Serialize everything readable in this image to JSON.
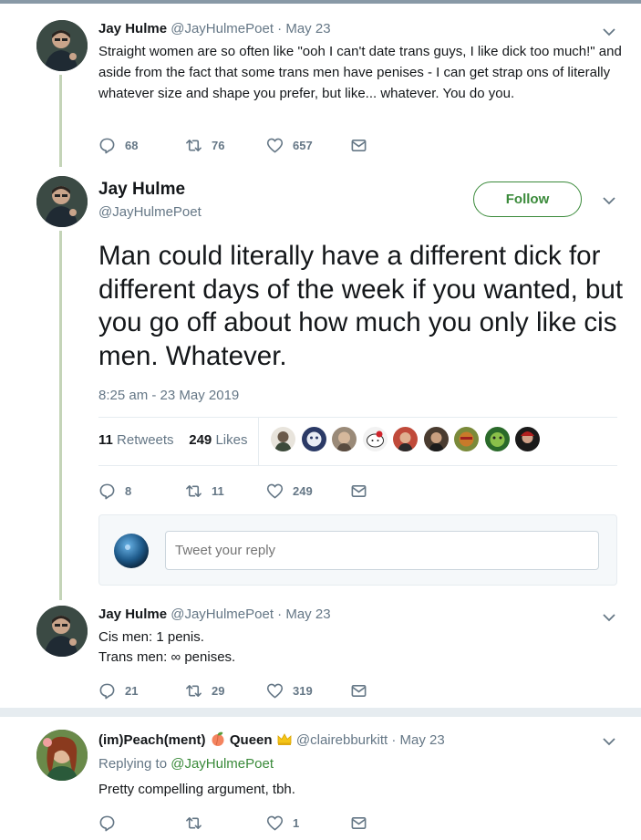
{
  "tweet1": {
    "name": "Jay Hulme",
    "handle": "@JayHulmePoet",
    "date": "May 23",
    "text": "Straight women are so often like \"ooh I can't date trans guys, I like dick too much!\" and aside from the fact that some trans men have penises - I can get strap ons of literally whatever size and shape you prefer, but like... whatever. You do you.",
    "replies": "68",
    "retweets": "76",
    "likes": "657"
  },
  "main_tweet": {
    "name": "Jay Hulme",
    "handle": "@JayHulmePoet",
    "follow_label": "Follow",
    "text": "Man could literally have a different dick for different days of the week if you wanted, but you go off about how much you only like cis men. Whatever.",
    "timestamp": "8:25 am - 23 May 2019",
    "retweet_count": "11",
    "retweet_label": "Retweets",
    "like_count": "249",
    "like_label": "Likes",
    "replies": "8",
    "retweets": "11",
    "likes": "249",
    "reply_placeholder": "Tweet your reply"
  },
  "tweet3": {
    "name": "Jay Hulme",
    "handle": "@JayHulmePoet",
    "date": "May 23",
    "line1": "Cis men: 1 penis.",
    "line2": "Trans men: ∞ penises.",
    "replies": "21",
    "retweets": "29",
    "likes": "319"
  },
  "tweet4": {
    "name": "(im)Peach(ment)",
    "name_suffix": "Queen",
    "handle": "@clairebburkitt",
    "date": "May 23",
    "replying_label": "Replying to",
    "replying_to": "@JayHulmePoet",
    "text": "Pretty compelling argument, tbh.",
    "replies": "",
    "retweets": "",
    "likes": "1"
  },
  "separator_dot": "·",
  "colors": {
    "accent": "#3a8a3a",
    "muted": "#657786",
    "thread_line": "#c4d4b8"
  },
  "icons": [
    "reply-icon",
    "retweet-icon",
    "like-icon",
    "dm-icon",
    "chevron-down-icon",
    "peach-emoji-icon",
    "crown-emoji-icon"
  ]
}
